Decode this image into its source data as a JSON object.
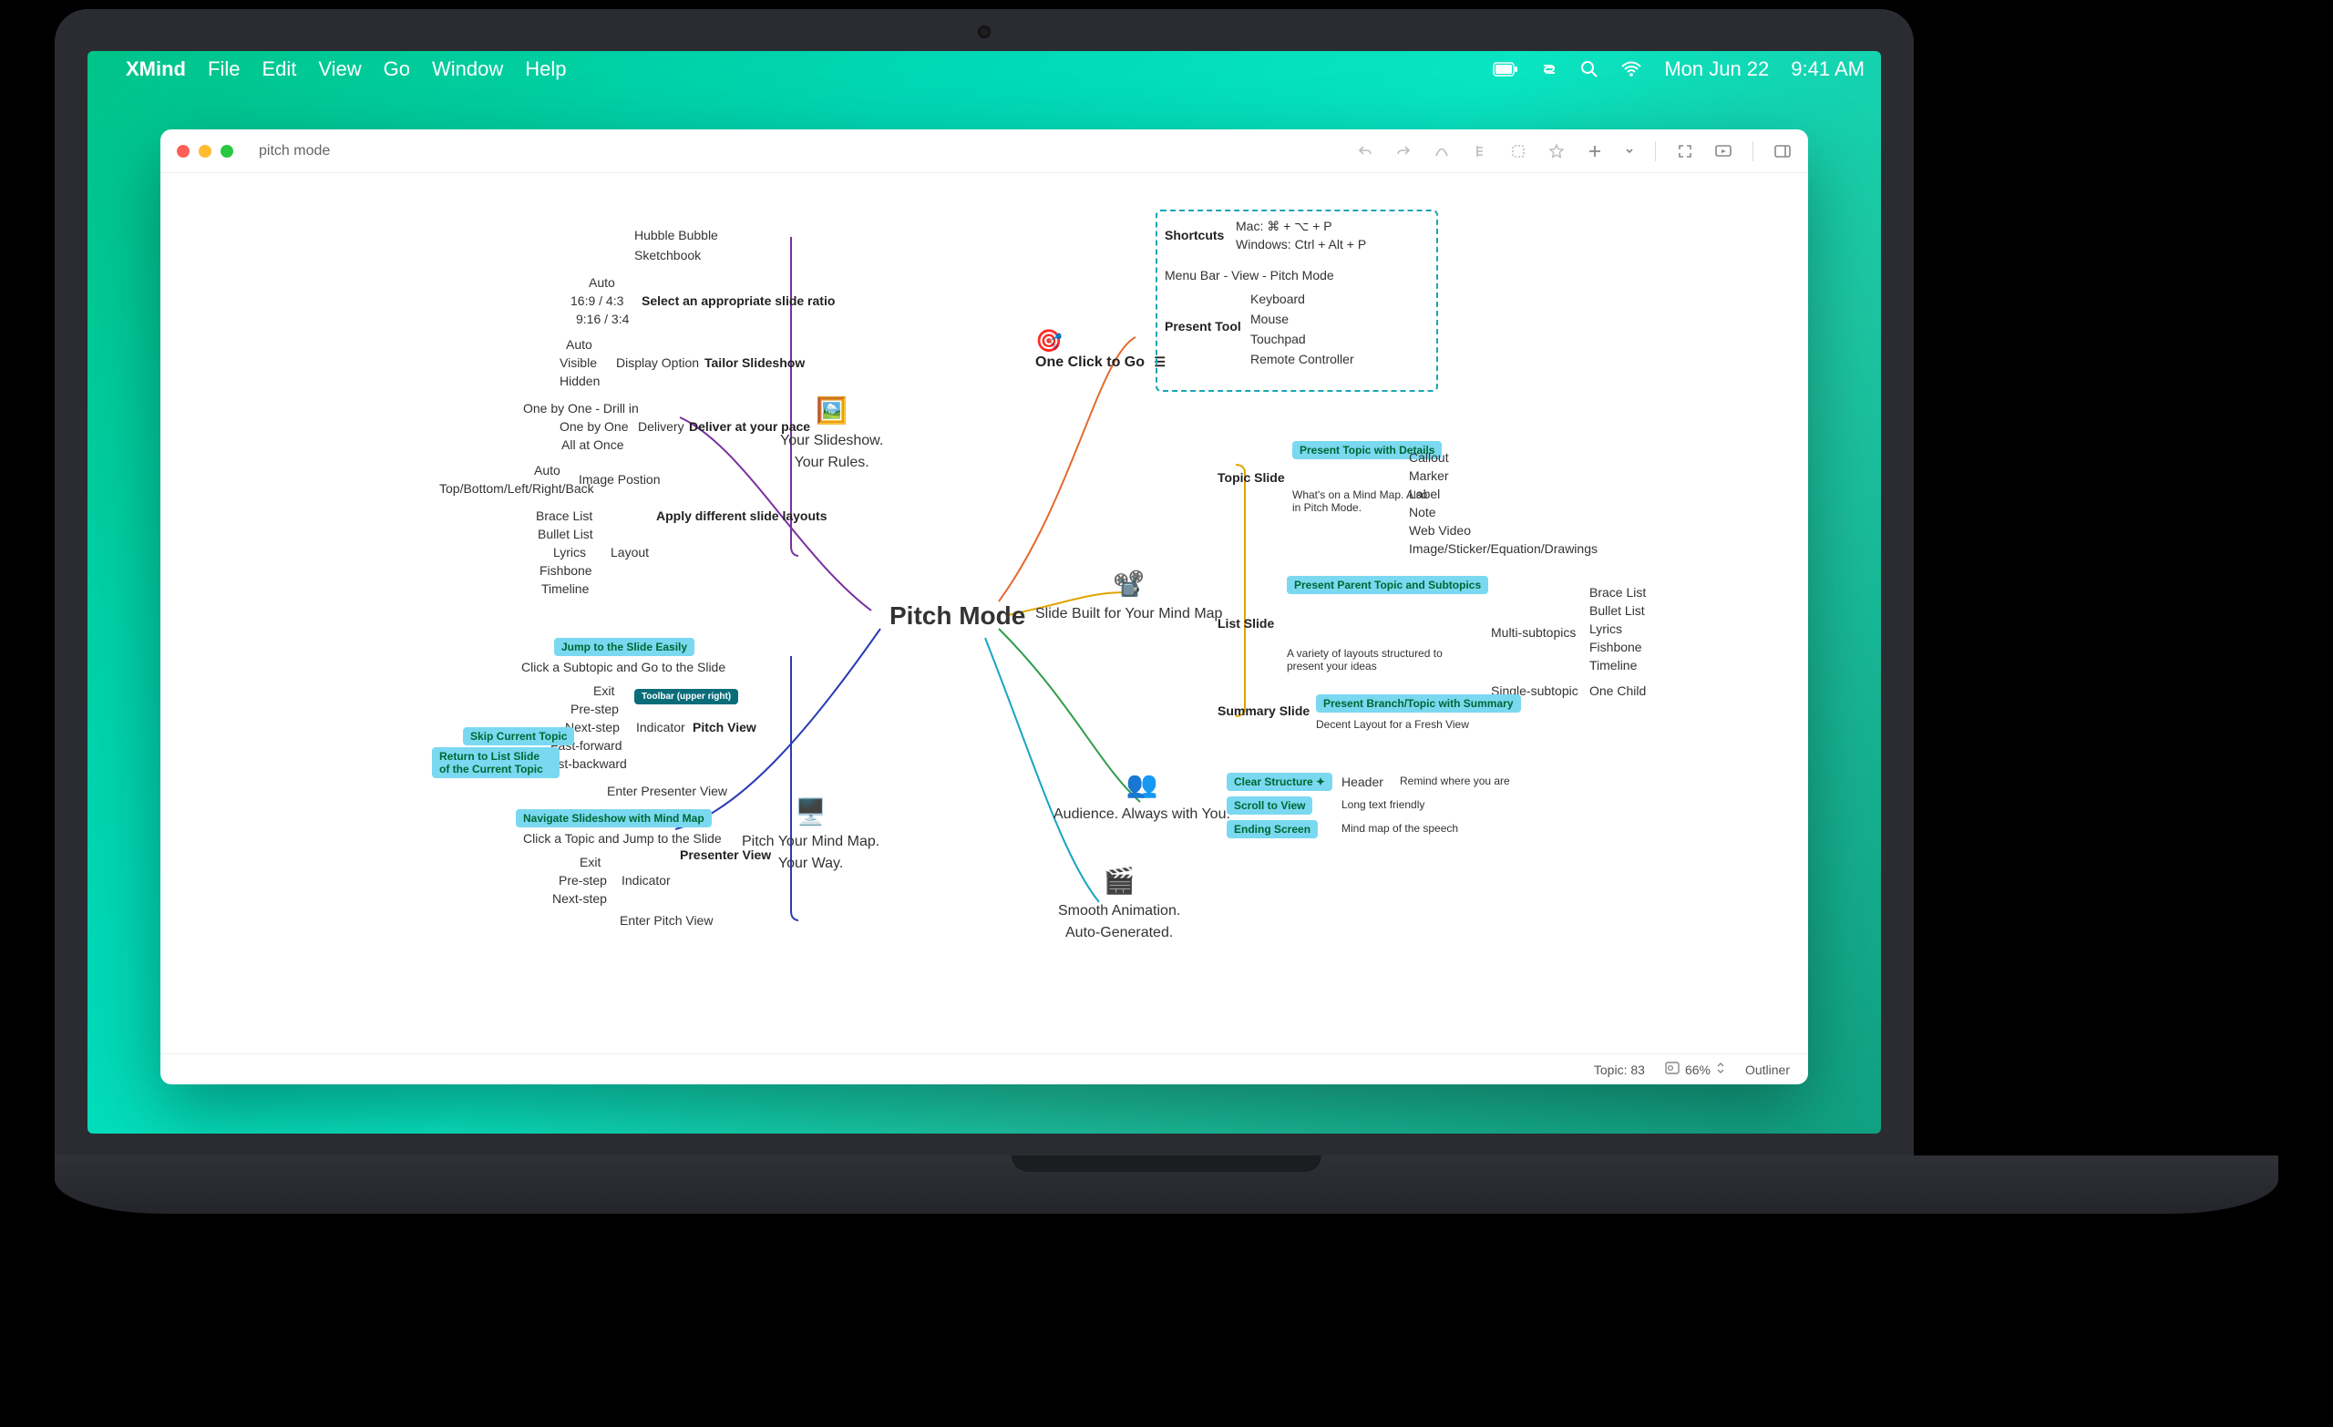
{
  "menubar": {
    "app_name": "XMind",
    "items": [
      "File",
      "Edit",
      "View",
      "Go",
      "Window",
      "Help"
    ],
    "date": "Mon Jun 22",
    "time": "9:41 AM"
  },
  "titlebar": {
    "doc_title": "pitch mode"
  },
  "statusbar": {
    "topic_label": "Topic:",
    "topic_count": "83",
    "zoom": "66%",
    "outliner": "Outliner"
  },
  "mindmap": {
    "center": "Pitch Mode",
    "your_slideshow": {
      "title1": "Your Slideshow.",
      "title2": "Your Rules."
    },
    "pitch_your_way": {
      "title1": "Pitch Your Mind Map.",
      "title2": "Your Way."
    },
    "one_click": "One Click to Go",
    "slide_built": "Slide Built for Your Mind Map",
    "audience": "Audience. Always with You.",
    "smooth": {
      "title1": "Smooth Animation.",
      "title2": "Auto-Generated."
    },
    "left_top_items": [
      "Hubble Bubble",
      "Sketchbook"
    ],
    "ratio_items": [
      "Auto",
      "16:9 / 4:3",
      "9:16 / 3:4"
    ],
    "ratio_label": "Select an appropriate slide ratio",
    "display_items": [
      "Auto",
      "Visible",
      "Hidden"
    ],
    "display_label": "Display Option",
    "tailor": "Tailor Slideshow",
    "deliver_items": [
      "One by One - Drill in",
      "One by One",
      "All at Once"
    ],
    "deliver_mid": "Delivery",
    "deliver_label": "Deliver at your pace",
    "imgpos_items": [
      "Auto",
      "Top/Bottom/Left/Right/Back"
    ],
    "imgpos_label": "Image Postion",
    "layout_items": [
      "Brace List",
      "Bullet List",
      "Lyrics",
      "Fishbone",
      "Timeline"
    ],
    "layout_mid": "Layout",
    "layouts_label": "Apply different slide layouts",
    "jump_tag": "Jump to the Slide Easily",
    "jump_sub": "Click a Subtopic and Go to the Slide",
    "pitch_items": [
      "Exit",
      "Pre-step",
      "Next-step",
      "Fast-forward",
      "Fast-backward"
    ],
    "toolbar_tag": "Toolbar (upper right)",
    "indicator": "Indicator",
    "pitch_view": "Pitch View",
    "skip_tag": "Skip Current Topic",
    "return_tag": "Return to List Slide of the Current Topic",
    "enter_presenter": "Enter Presenter View",
    "nav_tag": "Navigate Slideshow with Mind Map",
    "nav_sub": "Click a Topic and Jump to the Slide",
    "pres_items": [
      "Exit",
      "Pre-step",
      "Next-step"
    ],
    "pres_indicator": "Indicator",
    "presenter_view": "Presenter View",
    "enter_pitch": "Enter Pitch View",
    "shortcuts_label": "Shortcuts",
    "shortcuts_mac": "Mac: ⌘ + ⌥ + P",
    "shortcuts_win": "Windows: Ctrl + Alt + P",
    "menu_bar_path": "Menu Bar - View - Pitch Mode",
    "present_tool": "Present Tool",
    "present_items": [
      "Keyboard",
      "Mouse",
      "Touchpad",
      "Remote Controller"
    ],
    "topic_slide": "Topic Slide",
    "topic_tag": "Present Topic with Details",
    "whats_on": "What's on a Mind Map. Also in Pitch Mode.",
    "topic_items": [
      "Callout",
      "Marker",
      "Label",
      "Note",
      "Web Video",
      "Image/Sticker/Equation/Drawings"
    ],
    "list_slide": "List Slide",
    "list_tag": "Present Parent Topic and Subtopics",
    "list_variety": "A variety of layouts structured to present your ideas",
    "multi": "Multi-subtopics",
    "single": "Single-subtopic",
    "multi_items": [
      "Brace List",
      "Bullet List",
      "Lyrics",
      "Fishbone",
      "Timeline"
    ],
    "single_item": "One Child",
    "summary_slide": "Summary Slide",
    "summary_tag": "Present Branch/Topic with Summary",
    "summary_sub": "Decent Layout for a Fresh View",
    "clear_tag": "Clear Structure",
    "scroll_tag": "Scroll to View",
    "ending_tag": "Ending Screen",
    "header_label": "Header",
    "header_sub": "Remind where you are",
    "scroll_sub": "Long text friendly",
    "ending_sub": "Mind map of the speech"
  }
}
